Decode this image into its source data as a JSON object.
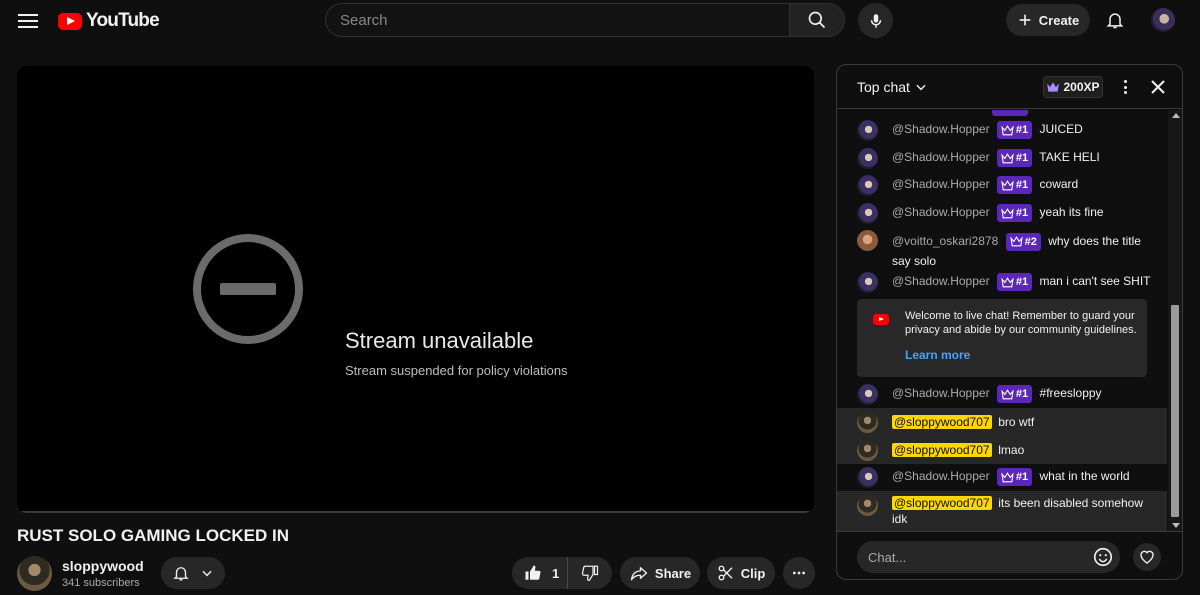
{
  "header": {
    "logo_text": "YouTube",
    "search_placeholder": "Search",
    "create_label": "Create"
  },
  "player": {
    "error_title": "Stream unavailable",
    "error_subtitle": "Stream suspended for policy violations"
  },
  "video": {
    "title": "RUST SOLO GAMING LOCKED IN",
    "channel_name": "sloppywood",
    "subscribers": "341 subscribers",
    "like_count": "1",
    "share_label": "Share",
    "clip_label": "Clip"
  },
  "chat": {
    "mode_label": "Top chat",
    "xp_badge": "200XP",
    "input_placeholder": "Chat...",
    "welcome": {
      "text": "Welcome to live chat! Remember to guard your privacy and abide by our community guidelines.",
      "link": "Learn more"
    },
    "messages": [
      {
        "author": "@Shadow.Hopper",
        "rank": "#1",
        "text": "JUICED"
      },
      {
        "author": "@Shadow.Hopper",
        "rank": "#1",
        "text": "TAKE HELI"
      },
      {
        "author": "@Shadow.Hopper",
        "rank": "#1",
        "text": "coward"
      },
      {
        "author": "@Shadow.Hopper",
        "rank": "#1",
        "text": "yeah its fine"
      },
      {
        "author": "@voitto_oskari2878",
        "rank": "#2",
        "text": "why does the title say solo"
      },
      {
        "author": "@Shadow.Hopper",
        "rank": "#1",
        "text": "man i can't see SHIT"
      },
      {
        "author": "@Shadow.Hopper",
        "rank": "#1",
        "text": "#freesloppy"
      },
      {
        "author": "@sloppywood707",
        "text": "bro wtf"
      },
      {
        "author": "@sloppywood707",
        "text": "lmao"
      },
      {
        "author": "@Shadow.Hopper",
        "rank": "#1",
        "text": "what in the world"
      },
      {
        "author": "@sloppywood707",
        "text": "its been disabled somehow idk"
      }
    ]
  },
  "colors": {
    "background": "#0f0f0f",
    "brand_red": "#ff0000",
    "rank_badge": "#5b27b8",
    "owner_highlight": "#ffd600",
    "link_blue": "#3ea6ff"
  },
  "icons": [
    "menu-icon",
    "youtube-logo-icon",
    "search-icon",
    "mic-icon",
    "plus-icon",
    "bell-icon",
    "stop-circle-icon",
    "chevron-down-icon",
    "like-icon",
    "dislike-icon",
    "share-icon",
    "scissors-icon",
    "more-icon",
    "crown-icon",
    "close-icon",
    "emoji-icon",
    "heart-icon"
  ]
}
